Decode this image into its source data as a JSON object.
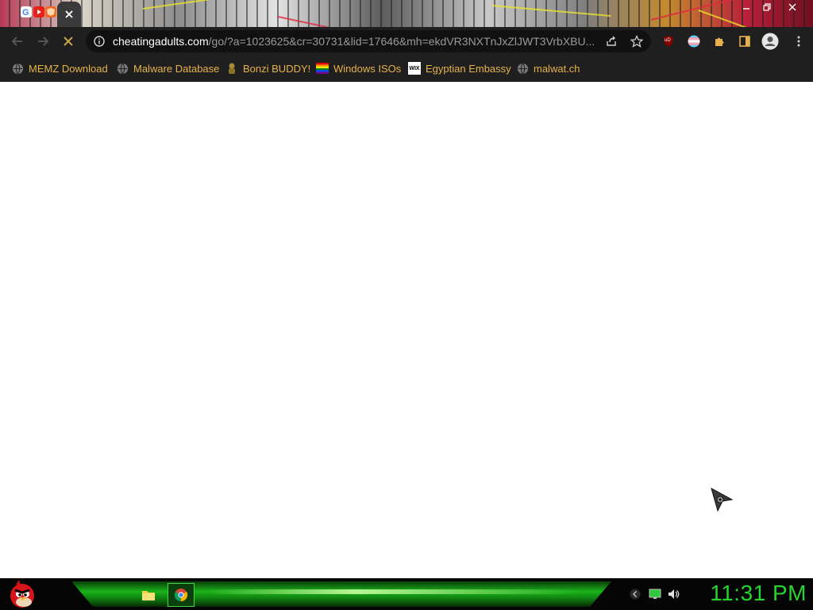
{
  "browser": {
    "url": {
      "host": "cheatingadults.com",
      "path": "/go/?a=1023625&cr=30731&lid=17646&mh=ekdVR3NXTnJxZlJWT3VrbXBU..."
    },
    "bookmarks": [
      {
        "label": "MEMZ Download",
        "icon": "globe-icon"
      },
      {
        "label": "Malware Database",
        "icon": "globe-icon"
      },
      {
        "label": "Bonzi BUDDY!",
        "icon": "bonzi-icon"
      },
      {
        "label": "Windows ISOs",
        "icon": "rainbow-flag-icon"
      },
      {
        "label": "Egyptian Embassy",
        "icon": "wix-icon"
      },
      {
        "label": "malwat.ch",
        "icon": "globe-icon"
      }
    ],
    "extension_labels": {
      "ublock": "uD"
    },
    "wix_icon_text": "WIX"
  },
  "taskbar": {
    "clock": "11:31 PM"
  },
  "colors": {
    "accent_green": "#29d32f",
    "bookmark_text": "#e7b24a",
    "toolbar_bg": "#1f1f1f"
  }
}
